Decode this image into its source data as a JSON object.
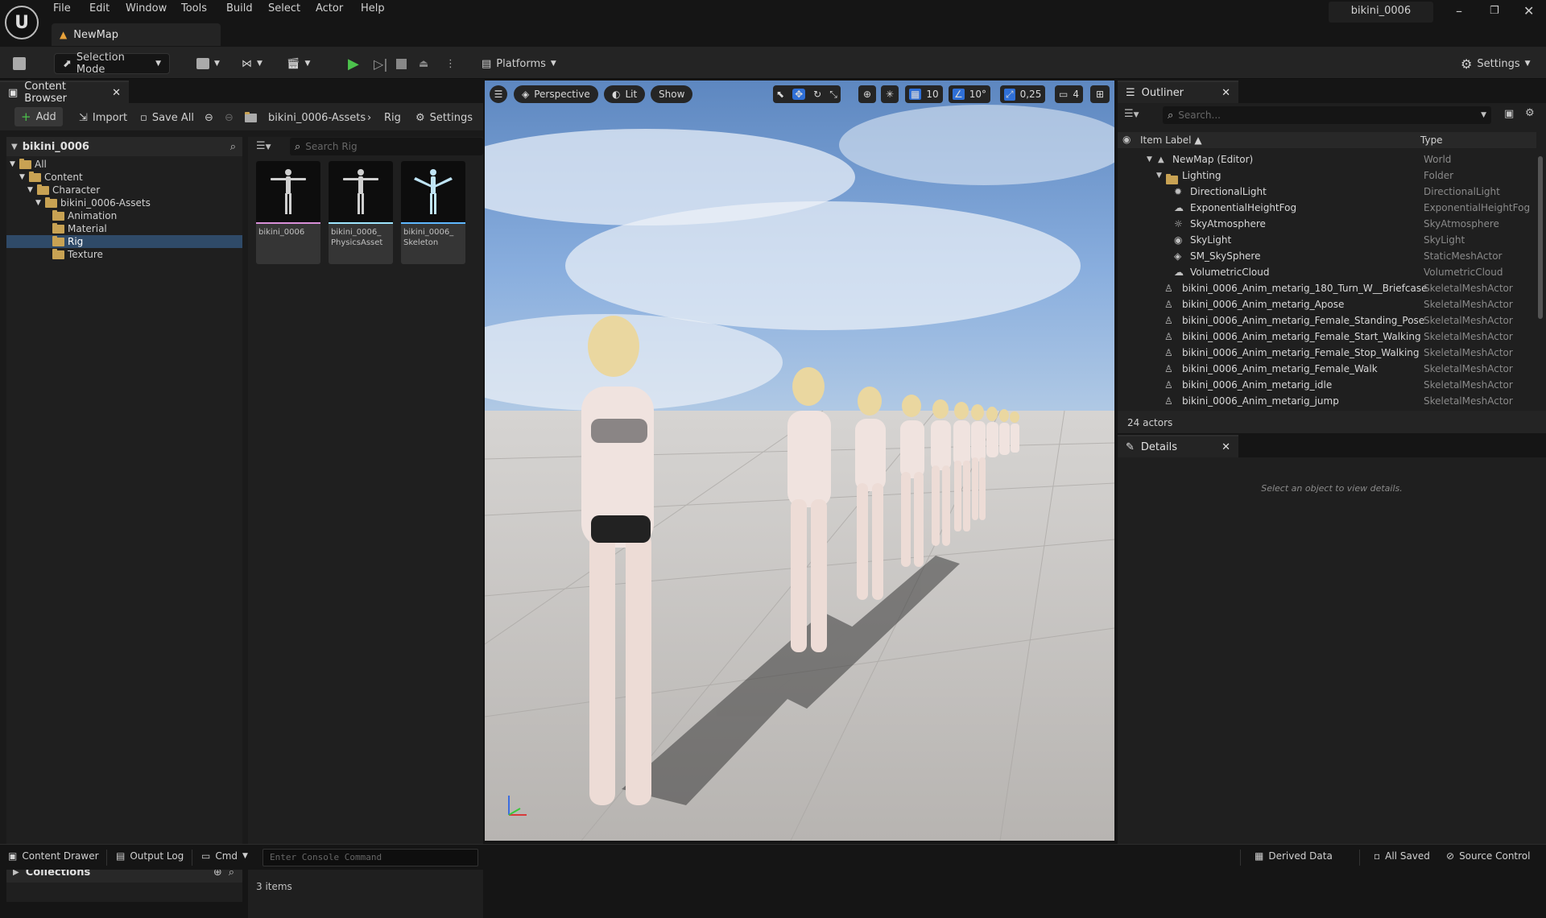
{
  "app": {
    "project": "bikini_0006",
    "map_tab": "NewMap"
  },
  "menu": [
    "File",
    "Edit",
    "Window",
    "Tools",
    "Build",
    "Select",
    "Actor",
    "Help"
  ],
  "toolbar": {
    "mode": "Selection Mode",
    "platforms": "Platforms",
    "settings": "Settings"
  },
  "content_browser": {
    "tab": "Content Browser",
    "add": "Add",
    "import": "Import",
    "save_all": "Save All",
    "path": [
      "bikini_0006-Assets",
      "Rig"
    ],
    "settings": "Settings",
    "root": "bikini_0006",
    "search_placeholder": "Search Rig",
    "tree": [
      {
        "label": "All",
        "depth": 0
      },
      {
        "label": "Content",
        "depth": 1
      },
      {
        "label": "Character",
        "depth": 2
      },
      {
        "label": "bikini_0006-Assets",
        "depth": 3
      },
      {
        "label": "Animation",
        "depth": 4
      },
      {
        "label": "Material",
        "depth": 4
      },
      {
        "label": "Rig",
        "depth": 4,
        "selected": true
      },
      {
        "label": "Texture",
        "depth": 4
      }
    ],
    "assets": [
      {
        "label": "bikini_0006",
        "color": "#d88fd8"
      },
      {
        "label": "bikini_0006_ PhysicsAsset",
        "color": "#9ee6ff"
      },
      {
        "label": "bikini_0006_ Skeleton",
        "color": "#5fb8ff"
      }
    ],
    "collections": "Collections",
    "item_count": "3 items"
  },
  "viewport": {
    "perspective": "Perspective",
    "lit": "Lit",
    "show": "Show",
    "grid_snap": "10",
    "angle_snap": "10°",
    "scale_snap": "0,25",
    "camera_speed": "4"
  },
  "outliner": {
    "tab": "Outliner",
    "search_placeholder": "Search...",
    "col_label": "Item Label ▲",
    "col_type": "Type",
    "rows": [
      {
        "label": "NewMap (Editor)",
        "type": "World",
        "indent": 0,
        "expander": "▼",
        "icon": "▲"
      },
      {
        "label": "Lighting",
        "type": "Folder",
        "indent": 1,
        "expander": "▼",
        "icon": "folder"
      },
      {
        "label": "DirectionalLight",
        "type": "DirectionalLight",
        "indent": 2,
        "icon": "✹"
      },
      {
        "label": "ExponentialHeightFog",
        "type": "ExponentialHeightFog",
        "indent": 2,
        "icon": "☁"
      },
      {
        "label": "SkyAtmosphere",
        "type": "SkyAtmosphere",
        "indent": 2,
        "icon": "☼"
      },
      {
        "label": "SkyLight",
        "type": "SkyLight",
        "indent": 2,
        "icon": "◉"
      },
      {
        "label": "SM_SkySphere",
        "type": "StaticMeshActor",
        "indent": 2,
        "icon": "◈"
      },
      {
        "label": "VolumetricCloud",
        "type": "VolumetricCloud",
        "indent": 2,
        "icon": "☁"
      },
      {
        "label": "bikini_0006_Anim_metarig_180_Turn_W__Briefcase",
        "type": "SkeletalMeshActor",
        "indent": 1,
        "icon": "♙"
      },
      {
        "label": "bikini_0006_Anim_metarig_Apose",
        "type": "SkeletalMeshActor",
        "indent": 1,
        "icon": "♙"
      },
      {
        "label": "bikini_0006_Anim_metarig_Female_Standing_Pose",
        "type": "SkeletalMeshActor",
        "indent": 1,
        "icon": "♙"
      },
      {
        "label": "bikini_0006_Anim_metarig_Female_Start_Walking",
        "type": "SkeletalMeshActor",
        "indent": 1,
        "icon": "♙"
      },
      {
        "label": "bikini_0006_Anim_metarig_Female_Stop_Walking",
        "type": "SkeletalMeshActor",
        "indent": 1,
        "icon": "♙"
      },
      {
        "label": "bikini_0006_Anim_metarig_Female_Walk",
        "type": "SkeletalMeshActor",
        "indent": 1,
        "icon": "♙"
      },
      {
        "label": "bikini_0006_Anim_metarig_idle",
        "type": "SkeletalMeshActor",
        "indent": 1,
        "icon": "♙"
      },
      {
        "label": "bikini_0006_Anim_metarig_jump",
        "type": "SkeletalMeshActor",
        "indent": 1,
        "icon": "♙"
      }
    ],
    "actor_count": "24 actors"
  },
  "details": {
    "tab": "Details",
    "empty": "Select an object to view details."
  },
  "statusbar": {
    "content_drawer": "Content Drawer",
    "output_log": "Output Log",
    "cmd": "Cmd",
    "console_placeholder": "Enter Console Command",
    "derived_data": "Derived Data",
    "all_saved": "All Saved",
    "source_control": "Source Control"
  }
}
